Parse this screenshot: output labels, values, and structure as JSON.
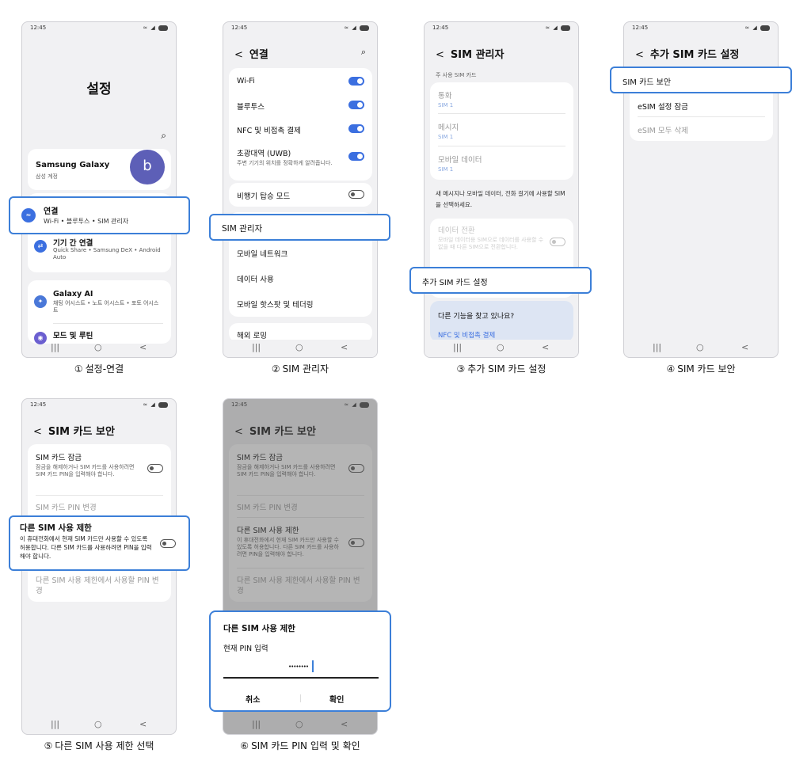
{
  "status": {
    "time": "12:45",
    "battery": "100"
  },
  "nav": {
    "recent": "|||",
    "home": "○",
    "back": "<"
  },
  "icons": {
    "back": "<",
    "search": "⌕"
  },
  "colors": {
    "accent": "#3c7fd8",
    "toggle_on": "#3b6fe0",
    "avatar": "#5d5fb7"
  },
  "steps": [
    {
      "num": "①",
      "label": "설정-연결"
    },
    {
      "num": "②",
      "label": "SIM 관리자"
    },
    {
      "num": "③",
      "label": "추가 SIM 카드 설정"
    },
    {
      "num": "④",
      "label": "SIM 카드 보안"
    },
    {
      "num": "⑤",
      "label": "다른 SIM 사용 제한 선택"
    },
    {
      "num": "⑥",
      "label": "SIM 카드 PIN 입력 및 확인"
    }
  ],
  "screen1": {
    "title": "설정",
    "account_name": "Samsung Galaxy",
    "account_sub": "삼성 계정",
    "avatar_letter": "b",
    "connections_title": "연결",
    "connections_sub": "Wi-Fi • 블루투스 • SIM 관리자",
    "devices_title": "기기 간 연결",
    "devices_sub": "Quick Share • Samsung DeX • Android Auto",
    "ai_title": "Galaxy AI",
    "ai_sub": "채팅 어시스트 • 노트 어시스트 • 포토 어시스트",
    "modes_title": "모드 및 루틴"
  },
  "screen2": {
    "title": "연결",
    "wifi": "Wi-Fi",
    "bluetooth": "블루투스",
    "nfc": "NFC 및 비접촉 결제",
    "uwb": "초광대역 (UWB)",
    "uwb_sub": "주변 기기의 위치를 정확하게 알려줍니다.",
    "airplane": "비행기 탑승 모드",
    "sim_manager": "SIM 관리자",
    "mobile_networks": "모바일 네트워크",
    "data_usage": "데이터 사용",
    "hotspot": "모바일 핫스팟 및 테더링",
    "roaming": "해외 로밍"
  },
  "screen3": {
    "title": "SIM 관리자",
    "section": "주 사용 SIM 카드",
    "calls": "통화",
    "calls_sub": "SIM 1",
    "messages": "메시지",
    "messages_sub": "SIM 1",
    "mobile_data": "모바일 데이터",
    "mobile_data_sub": "SIM 1",
    "notice": "새 메시지나 모바일 데이터, 전화 걸기에 사용할 SIM을 선택하세요.",
    "data_switch": "데이터 전환",
    "data_switch_sub": "모바일 데이터용 SIM으로 데이터를 사용할 수 없을 때 다른 SIM으로 전환합니다.",
    "more_sim": "추가 SIM 카드 설정",
    "looking": "다른 기능을 찾고 있나요?",
    "nfc_link": "NFC 및 비접촉 결제"
  },
  "screen4": {
    "title": "추가 SIM 카드 설정",
    "sim_security": "SIM 카드 보안",
    "esim_lock": "eSIM 설정 잠금",
    "esim_delete": "eSIM 모두 삭제"
  },
  "screen5": {
    "title": "SIM 카드 보안",
    "lock_title": "SIM 카드 잠금",
    "lock_sub": "잠금을 해제하거나 SIM 카드를 사용하려면 SIM 카드 PIN을 입력해야 합니다.",
    "pin_change": "SIM 카드 PIN 변경",
    "restrict_title": "다른 SIM 사용 제한",
    "restrict_sub": "이 휴대전화에서 현재 SIM 카드만 사용할 수 있도록 허용합니다. 다른 SIM 카드를 사용하려면 PIN을 입력해야 합니다.",
    "restrict_pin": "다른 SIM 사용 제한에서 사용할 PIN 변경"
  },
  "screen6": {
    "dialog_title": "다른 SIM 사용 제한",
    "dialog_label": "현재 PIN 입력",
    "pin_value": "••••••••",
    "cancel": "취소",
    "confirm": "확인"
  }
}
